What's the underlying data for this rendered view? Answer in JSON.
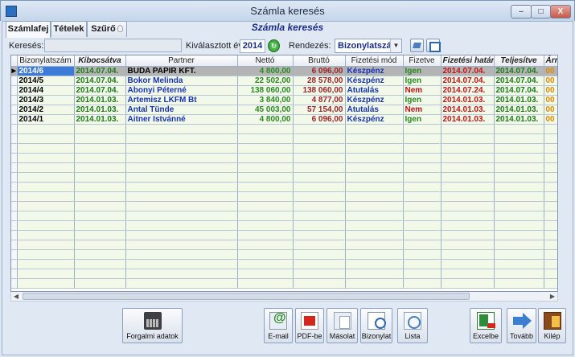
{
  "window": {
    "title": "Számla keresés",
    "min": "–",
    "max": "□",
    "close": "X"
  },
  "tabs": [
    {
      "label": "Számlafej"
    },
    {
      "label": "Tételek"
    },
    {
      "label": "Szűrő"
    }
  ],
  "page_title": "Számla keresés",
  "toolbar": {
    "search_label": "Keresés:",
    "search_value": "",
    "year_label": "Kiválasztott év:",
    "year_value": "2014",
    "sort_label": "Rendezés:",
    "sort_value": "Bizonylatszám"
  },
  "table": {
    "columns": [
      "Bizonylatszám",
      "Kibocsátva",
      "Partner",
      "Nettó",
      "Bruttó",
      "Fizetési mód",
      "Fizetve",
      "Fizetési határ",
      "Teljesítve",
      "Árr"
    ],
    "rows": [
      [
        "2014/6",
        "2014.07.04.",
        "BUDA PAPIR KFT.",
        "4 800,00",
        "6 096,00",
        "Készpénz",
        "Igen",
        "2014.07.04.",
        "2014.07.04.",
        "00"
      ],
      [
        "2014/5",
        "2014.07.04.",
        "Bokor Melinda",
        "22 502,00",
        "28 578,00",
        "Készpénz",
        "Igen",
        "2014.07.04.",
        "2014.07.04.",
        "00"
      ],
      [
        "2014/4",
        "2014.07.04.",
        "Abonyi Péterné",
        "138 060,00",
        "138 060,00",
        "Átutalás",
        "Nem",
        "2014.07.24.",
        "2014.07.04.",
        "00"
      ],
      [
        "2014/3",
        "2014.01.03.",
        "Artemisz LKFM Bt",
        "3 840,00",
        "4 877,00",
        "Készpénz",
        "Igen",
        "2014.01.03.",
        "2014.01.03.",
        "00"
      ],
      [
        "2014/2",
        "2014.01.03.",
        "Antal Tünde",
        "45 003,00",
        "57 154,00",
        "Átutalás",
        "Nem",
        "2014.01.03.",
        "2014.01.03.",
        "00"
      ],
      [
        "2014/1",
        "2014.01.03.",
        "Aitner Istvánné",
        "4 800,00",
        "6 096,00",
        "Készpénz",
        "Igen",
        "2014.01.03.",
        "2014.01.03.",
        "00"
      ]
    ],
    "current_row_marker": "▶"
  },
  "buttons": {
    "forgalmi": "Forgalmi adatok",
    "email": "E-mail",
    "pdf": "PDF-be",
    "masolat": "Másolat",
    "bizonylat": "Bizonylat",
    "lista": "Lista",
    "excel": "Excelbe",
    "tovabb": "Tovább",
    "kilep": "Kilép"
  },
  "colors": {
    "accent": "#1a2d8c",
    "selected_row": "#3d7bd9",
    "row_bg": "#f2f9e9",
    "paid_yes": "#2a8a1f",
    "paid_no": "#c41414"
  }
}
